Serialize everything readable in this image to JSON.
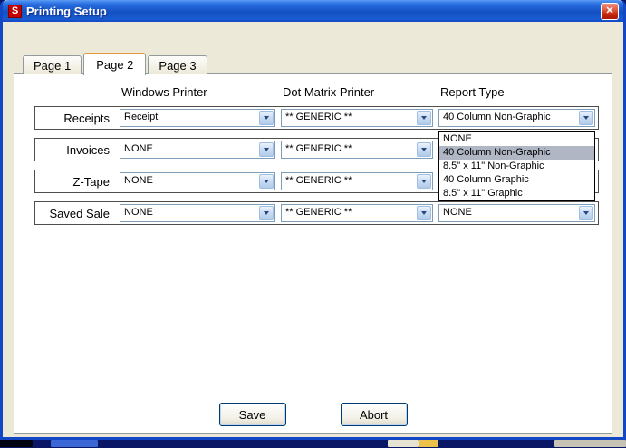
{
  "window": {
    "title": "Printing Setup",
    "icon_letter": "S",
    "close_glyph": "✕"
  },
  "tabs": [
    {
      "label": "Page 1",
      "active": false
    },
    {
      "label": "Page 2",
      "active": true
    },
    {
      "label": "Page 3",
      "active": false
    }
  ],
  "columns": {
    "windows_printer": "Windows Printer",
    "dot_matrix": "Dot Matrix Printer",
    "report_type": "Report Type"
  },
  "rows": [
    {
      "label": "Receipts",
      "windows_printer": "Receipt",
      "dot_matrix": "** GENERIC **",
      "report_type": "40 Column Non-Graphic"
    },
    {
      "label": "Invoices",
      "windows_printer": "NONE",
      "dot_matrix": "** GENERIC **",
      "report_type": ""
    },
    {
      "label": "Z-Tape",
      "windows_printer": "NONE",
      "dot_matrix": "** GENERIC **",
      "report_type": ""
    },
    {
      "label": "Saved Sale",
      "windows_printer": "NONE",
      "dot_matrix": "** GENERIC **",
      "report_type": "NONE"
    }
  ],
  "dropdown": {
    "attached_to": "receipts-report-type-select",
    "items": [
      "NONE",
      "40 Column Non-Graphic",
      "8.5\" x 11\" Non-Graphic",
      "40 Column Graphic",
      "8.5\" x 11\" Graphic"
    ],
    "selected_index": 1
  },
  "buttons": {
    "save": "Save",
    "abort": "Abort"
  },
  "colors": {
    "titlebar_blue": "#1350c4",
    "window_border": "#1247c6",
    "dropdown_highlight": "#b0b6c4",
    "close_red": "#c22507",
    "icon_red": "#c40000"
  }
}
